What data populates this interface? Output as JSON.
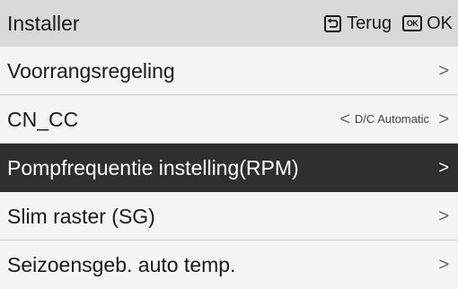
{
  "header": {
    "title": "Installer",
    "back_label": "Terug",
    "ok_icon_text": "OK",
    "ok_label": "OK",
    "back_icon": "return-arrow-icon"
  },
  "menu": {
    "items": [
      {
        "label": "Voorrangsregeling",
        "chevron": ">"
      },
      {
        "label": "CN_CC",
        "prev_chevron": "<",
        "value": "D/C Automatic",
        "chevron": ">"
      },
      {
        "label": "Pompfrequentie instelling(RPM)",
        "chevron": ">",
        "selected": true
      },
      {
        "label": "Slim raster (SG)",
        "chevron": ">"
      },
      {
        "label": "Seizoensgeb. auto temp.",
        "chevron": ">"
      }
    ]
  },
  "colors": {
    "header_bg": "#d9d9d9",
    "row_bg": "#f4f4f4",
    "selected_bg": "#2f2f2f",
    "selected_text": "#ffffff"
  }
}
